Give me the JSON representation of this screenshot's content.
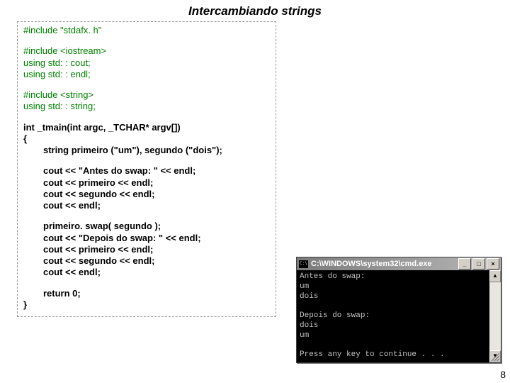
{
  "title": "Intercambiando strings",
  "code": {
    "l1": "#include \"stdafx. h\"",
    "l2": "#include <iostream>",
    "l3": "using std: : cout;",
    "l4": "using std: : endl;",
    "l5": "#include <string>",
    "l6": "using std: : string;",
    "l7a": "int",
    "l7b": " _tmain(",
    "l7c": "int",
    "l7d": " argc, _TCHAR* argv[])",
    "l8": "{",
    "l9a": "string primeiro (\"um\"), segundo (\"dois\");",
    "l10": "cout << \"Antes do swap: \" << endl;",
    "l11": "cout << primeiro               << endl;",
    "l12": "cout << segundo               << endl;",
    "l13": "cout << endl;",
    "l14a": "primeiro. ",
    "l14b": "swap",
    "l14c": "( segundo );",
    "l15": "cout << \"Depois do swap: \" << endl;",
    "l16": "cout << primeiro                  << endl;",
    "l17": "cout << segundo                  << endl;",
    "l18": "cout << endl;",
    "l19a": "return",
    "l19b": " 0;",
    "l20": "}"
  },
  "console": {
    "title": "C:\\WINDOWS\\system32\\cmd.exe",
    "min": "_",
    "max": "□",
    "close": "×",
    "out": "Antes do swap:\num\ndois\n\nDepois do swap:\ndois\num\n\nPress any key to continue . . ."
  },
  "pagenum": "8"
}
